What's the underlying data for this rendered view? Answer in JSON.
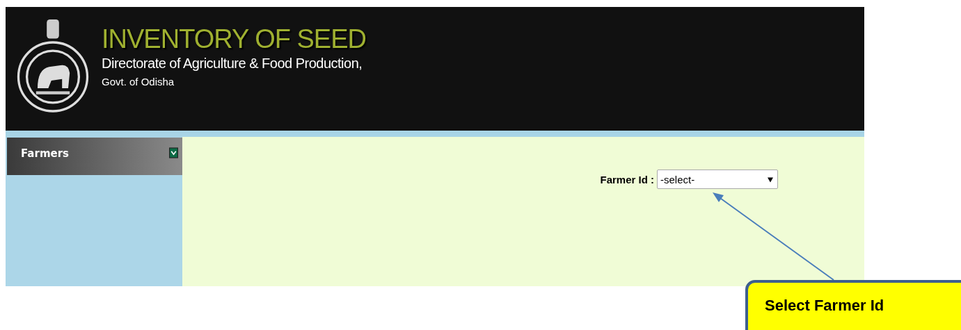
{
  "header": {
    "title": "INVENTORY OF SEED",
    "subtitle": "Directorate of Agriculture & Food Production,",
    "caption": "Govt. of Odisha"
  },
  "sidebar": {
    "menu": [
      {
        "label": "Farmers",
        "expanded": true
      }
    ]
  },
  "form": {
    "label": "Farmer Id :",
    "select": {
      "value": "-select-"
    }
  },
  "callout": {
    "text": "Select Farmer Id"
  }
}
